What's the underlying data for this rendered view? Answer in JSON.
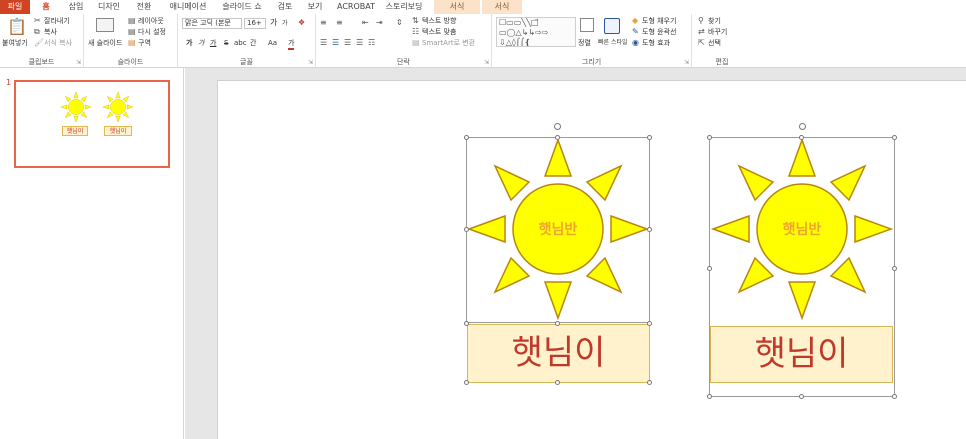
{
  "tabs": [
    {
      "label": "파일",
      "kind": "file"
    },
    {
      "label": "홈",
      "kind": "active"
    },
    {
      "label": "삽입",
      "kind": ""
    },
    {
      "label": "디자인",
      "kind": ""
    },
    {
      "label": "전환",
      "kind": ""
    },
    {
      "label": "애니메이션",
      "kind": ""
    },
    {
      "label": "슬라이드 쇼",
      "kind": ""
    },
    {
      "label": "검토",
      "kind": ""
    },
    {
      "label": "보기",
      "kind": ""
    },
    {
      "label": "ACROBAT",
      "kind": ""
    },
    {
      "label": "스토리보딩",
      "kind": ""
    },
    {
      "label": "서식",
      "kind": "ctx"
    },
    {
      "label": "서식",
      "kind": "ctx"
    }
  ],
  "ribbon": {
    "clipboard": {
      "paste": "붙여넣기",
      "cut": "잘라내기",
      "copy": "복사",
      "format_painter": "서식 복사",
      "label": "클립보드"
    },
    "slides": {
      "new_slide": "새 슬라이드",
      "layout": "레이아웃",
      "reset": "다시 설정",
      "section": "구역",
      "label": "슬라이드"
    },
    "font": {
      "font_name": "맑은 고딕 (본문",
      "font_size": "16+",
      "grow": "가",
      "shrink": "가",
      "bold": "가",
      "italic": "가",
      "underline": "가",
      "strike": "S",
      "shadow": "abc",
      "spacing": "간",
      "case": "Aa",
      "color": "가",
      "label": "글꼴"
    },
    "paragraph": {
      "text_direction": "텍스트 방향",
      "align_text": "텍스트 맞춤",
      "smartart": "SmartArt로 변환",
      "label": "단락"
    },
    "drawing": {
      "arrange": "정렬",
      "quick_styles": "빠른 스타일",
      "shape_fill": "도형 채우기",
      "shape_outline": "도형 윤곽선",
      "shape_effects": "도형 효과",
      "label": "그리기"
    },
    "editing": {
      "find": "찾기",
      "replace": "바꾸기",
      "select": "선택",
      "label": "편집"
    }
  },
  "thumbnail": {
    "number": "1",
    "label_left": "햇님이",
    "label_right": "햇님이"
  },
  "slide": {
    "sun_left_text": "햇님반",
    "sun_right_text": "햇님반",
    "caption_left": "햇님이",
    "caption_right": "햇님이"
  },
  "colors": {
    "sun_fill": "#ffff00",
    "sun_stroke": "#b8860b",
    "caption_fill": "#fff2cc",
    "caption_text": "#c0392b",
    "accent": "#d04423"
  }
}
